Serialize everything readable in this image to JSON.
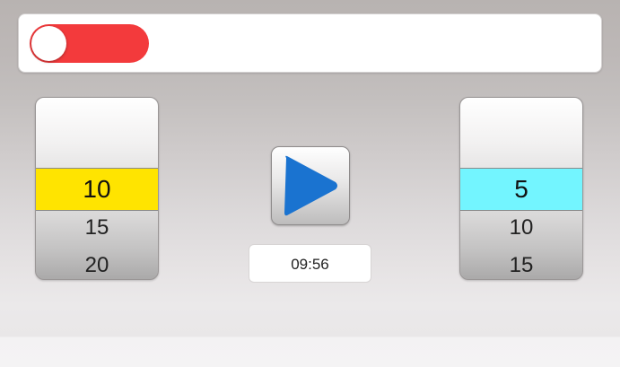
{
  "toggle": {
    "state": "off",
    "track_color": "#f33a3c"
  },
  "left_picker": {
    "items": [
      "10",
      "15",
      "20"
    ],
    "selected_index": 0,
    "highlight_color": "#ffe400"
  },
  "right_picker": {
    "items": [
      "5",
      "10",
      "15"
    ],
    "selected_index": 0,
    "highlight_color": "#73f5ff"
  },
  "play_button": {
    "icon": "play-icon",
    "icon_color": "#1a73d0"
  },
  "timer": {
    "display": "09:56"
  }
}
